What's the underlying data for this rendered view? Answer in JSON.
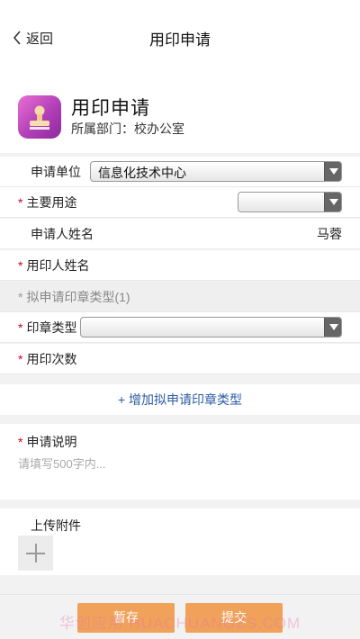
{
  "nav": {
    "back_label": "返回",
    "title": "用印申请"
  },
  "header": {
    "title": "用印申请",
    "department": "所属部门：校办公室"
  },
  "form": {
    "applicant_unit": {
      "label": "申请单位",
      "value": "信息化技术中心"
    },
    "main_purpose": {
      "label": "主要用途",
      "value": ""
    },
    "applicant_name": {
      "label": "申请人姓名",
      "value": "马蓉"
    },
    "seal_user_name": {
      "label": "用印人姓名"
    },
    "seal_type_section": {
      "label": "拟申请印章类型(1)"
    },
    "seal_type": {
      "label": "印章类型",
      "value": ""
    },
    "seal_count": {
      "label": "用印次数"
    },
    "add_seal_type": "+ 增加拟申请印章类型",
    "description": {
      "label": "申请说明",
      "placeholder": "请填写500字内..."
    },
    "attachment": {
      "label": "上传附件"
    }
  },
  "actions": {
    "save_label": "暂存",
    "submit_label": "提交"
  },
  "watermark": "华创应用 HUACHUANGZS.COM",
  "colors": {
    "required_star": "#d0021b",
    "link_blue": "#2b5aa3",
    "button_orange": "#f0a25a",
    "app_icon": "#c24fc1"
  }
}
